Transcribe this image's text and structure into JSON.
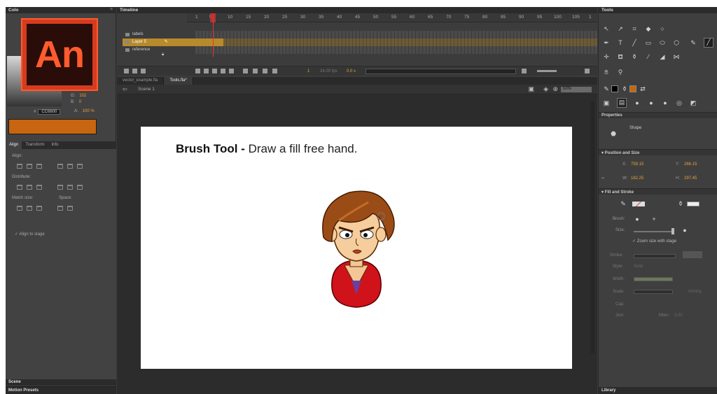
{
  "left_panel": {
    "color_header": "Colo",
    "logo_text": "An",
    "rgb": [
      {
        "label": "G:",
        "value": "102"
      },
      {
        "label": "B:",
        "value": "0"
      }
    ],
    "hex_label": "#",
    "hex_value": "CC6600",
    "alpha_label": "A:",
    "alpha_value": "100 %",
    "swatch_color": "#c86510",
    "tabs": [
      "Align",
      "Transform",
      "Info"
    ],
    "align_label": "Align:",
    "distribute_label": "Distribute:",
    "match_size_label": "Match size:",
    "space_label": "Space:",
    "align_to_stage": "Align to stage",
    "scene_label": "Scene",
    "motion_presets_label": "Motion Presets"
  },
  "timeline": {
    "header": "Timeline",
    "frame_numbers": [
      "1",
      "5",
      "10",
      "15",
      "20",
      "25",
      "30",
      "35",
      "40",
      "45",
      "50",
      "55",
      "60",
      "65",
      "70",
      "75",
      "80",
      "85",
      "90",
      "95",
      "100",
      "105",
      "1"
    ],
    "layers": [
      {
        "name": "labels",
        "selected": false
      },
      {
        "name": "Layer 5",
        "selected": true
      },
      {
        "name": "reference",
        "selected": false
      }
    ],
    "current_frame": "1",
    "fps": "24.00 fps",
    "time": "0.0 s"
  },
  "document": {
    "tabs": [
      {
        "label": "vector_example.fla",
        "active": false
      },
      {
        "label": "Tools.fla*",
        "active": true
      }
    ],
    "scene": "Scene 1",
    "zoom": "50%"
  },
  "stage": {
    "title_bold": "Brush Tool -",
    "title_rest": " Draw a fill free hand."
  },
  "right_panel": {
    "tools_header": "Tools",
    "properties_header": "Properties",
    "object_type": "Shape",
    "position_size_header": "Position and Size",
    "x_label": "X:",
    "x_value": "759.15",
    "y_label": "Y:",
    "y_value": "266.15",
    "w_label": "W:",
    "w_value": "182.25",
    "h_label": "H:",
    "h_value": "297.45",
    "fill_stroke_header": "Fill and Stroke",
    "brush_label": "Brush:",
    "size_label": "Size:",
    "zoom_with_stage": "Zoom size with stage",
    "stroke_label": "Stroke:",
    "style_label": "Style:",
    "style_value": "Solid",
    "width_label": "Width:",
    "scale_label": "Scale:",
    "hinting_label": "Hinting",
    "cap_label": "Cap:",
    "join_label": "Join:",
    "miter_label": "Miter:",
    "miter_value": "3.00",
    "library_label": "Library"
  }
}
